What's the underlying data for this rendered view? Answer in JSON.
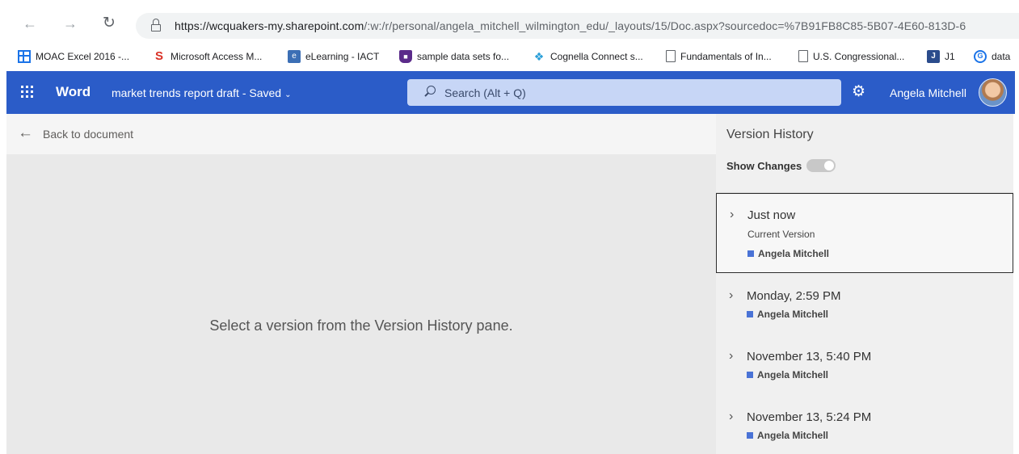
{
  "browser": {
    "url_host": "https://wcquakers-my.sharepoint.com",
    "url_rest": "/:w:/r/personal/angela_mitchell_wilmington_edu/_layouts/15/Doc.aspx?sourcedoc=%7B91FB8C85-5B07-4E60-813D-6",
    "bookmarks": [
      {
        "label": "MOAC Excel 2016 -...",
        "icon": "grid-icon"
      },
      {
        "label": "Microsoft Access M...",
        "icon": "s-logo-icon"
      },
      {
        "label": "eLearning - IACT",
        "icon": "elearning-icon"
      },
      {
        "label": "sample data sets fo...",
        "icon": "shield-icon"
      },
      {
        "label": "Cognella Connect s...",
        "icon": "diamond-icon"
      },
      {
        "label": "Fundamentals of In...",
        "icon": "page-icon"
      },
      {
        "label": "U.S. Congressional...",
        "icon": "page-icon"
      },
      {
        "label": "J1",
        "icon": "j-logo-icon"
      },
      {
        "label": "data",
        "icon": "g-logo-icon"
      }
    ]
  },
  "header": {
    "app_name": "Word",
    "doc_title": "market trends report draft",
    "save_status": "-  Saved",
    "search_placeholder": "Search (Alt + Q)",
    "user_name": "Angela Mitchell",
    "brand_color": "#2b5cc8"
  },
  "main": {
    "back_label": "Back to document",
    "message": "Select a version from the Version History pane."
  },
  "version_history": {
    "title": "Version History",
    "show_changes_label": "Show Changes",
    "show_changes_on": false,
    "versions": [
      {
        "time": "Just now",
        "sub": "Current Version",
        "author": "Angela Mitchell"
      },
      {
        "time": "Monday, 2:59 PM",
        "author": "Angela Mitchell"
      },
      {
        "time": "November 13, 5:40 PM",
        "author": "Angela Mitchell"
      },
      {
        "time": "November 13, 5:24 PM",
        "author": "Angela Mitchell"
      }
    ]
  }
}
